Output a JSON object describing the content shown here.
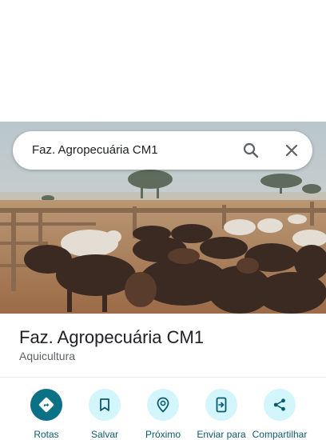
{
  "search": {
    "query": "Faz. Agropecuária CM1"
  },
  "place": {
    "name": "Faz. Agropecuária CM1",
    "category": "Aquicultura"
  },
  "actions": [
    {
      "label": "Rotas",
      "icon": "directions-icon"
    },
    {
      "label": "Salvar",
      "icon": "bookmark-icon"
    },
    {
      "label": "Próximo",
      "icon": "nearby-icon"
    },
    {
      "label": "Enviar para",
      "icon": "send-to-phone-icon"
    },
    {
      "label": "Compartilhar",
      "icon": "share-icon"
    }
  ],
  "colors": {
    "primary_action": "#0b7285",
    "action_circle": "#d3f5fc",
    "action_label": "#0b5b6b"
  }
}
